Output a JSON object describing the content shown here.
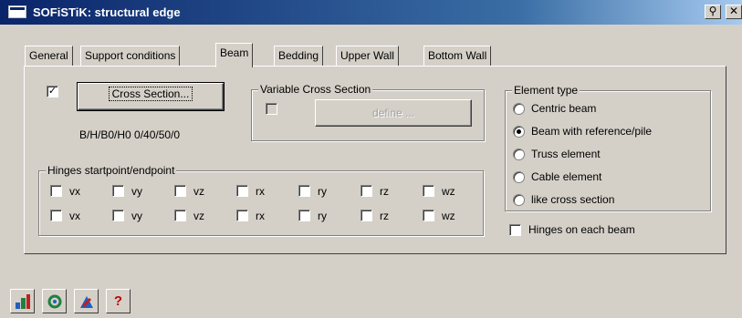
{
  "window": {
    "title": "SOFiSTiK: structural edge",
    "pin_glyph": "⚲",
    "close_glyph": "✕"
  },
  "tabs": [
    {
      "label": "General",
      "active": false
    },
    {
      "label": "Support conditions",
      "active": false
    },
    {
      "label": "Beam",
      "active": true
    },
    {
      "label": "Bedding",
      "active": false
    },
    {
      "label": "Upper Wall",
      "active": false
    },
    {
      "label": "Bottom Wall",
      "active": false
    }
  ],
  "beam": {
    "cross_section_checked": true,
    "check_glyph": "✓",
    "cross_section_button": "Cross Section...",
    "cross_section_text": "B/H/B0/H0 0/40/50/0",
    "variable_cross_section": {
      "legend": "Variable Cross Section",
      "checked": false,
      "define_button": "define ..."
    },
    "hinges": {
      "legend": "Hinges startpoint/endpoint",
      "row1": [
        "vx",
        "vy",
        "vz",
        "rx",
        "ry",
        "rz",
        "wz"
      ],
      "row2": [
        "vx",
        "vy",
        "vz",
        "rx",
        "ry",
        "rz",
        "wz"
      ]
    },
    "element_type": {
      "legend": "Element type",
      "options": [
        "Centric beam",
        "Beam with reference/pile",
        "Truss element",
        "Cable element",
        "like cross section"
      ],
      "selected": "Beam with reference/pile"
    },
    "hinges_on_each_beam": {
      "label": "Hinges on each beam",
      "checked": false
    }
  },
  "toolbar": {
    "icons": [
      "structure-wizard-icon",
      "settings-icon",
      "graphics-icon",
      "help-icon"
    ],
    "help_glyph": "?",
    "colors": {
      "help": "#c00000",
      "wizard": "#2060c0",
      "settings": "#208040",
      "graphics": "#c02020"
    }
  }
}
